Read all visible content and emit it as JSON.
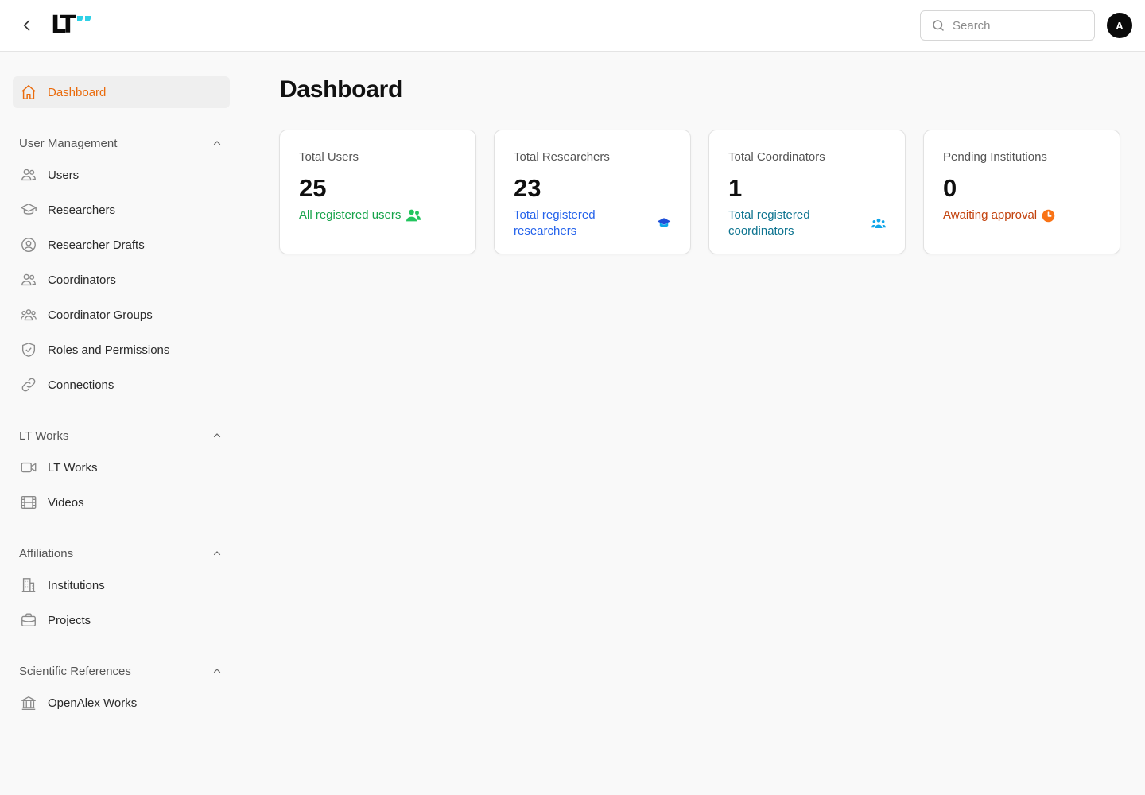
{
  "header": {
    "logo_text": "LT",
    "search_placeholder": "Search",
    "avatar_initial": "A"
  },
  "sidebar": {
    "dashboard": {
      "label": "Dashboard",
      "icon": "home-icon"
    },
    "sections": [
      {
        "title": "User Management",
        "items": [
          {
            "label": "Users",
            "icon": "users-icon"
          },
          {
            "label": "Researchers",
            "icon": "graduation-cap-icon"
          },
          {
            "label": "Researcher Drafts",
            "icon": "user-circle-icon"
          },
          {
            "label": "Coordinators",
            "icon": "users-icon"
          },
          {
            "label": "Coordinator Groups",
            "icon": "user-group-icon"
          },
          {
            "label": "Roles and Permissions",
            "icon": "shield-check-icon"
          },
          {
            "label": "Connections",
            "icon": "link-icon"
          }
        ]
      },
      {
        "title": "LT Works",
        "items": [
          {
            "label": "LT Works",
            "icon": "video-camera-icon"
          },
          {
            "label": "Videos",
            "icon": "film-icon"
          }
        ]
      },
      {
        "title": "Affiliations",
        "items": [
          {
            "label": "Institutions",
            "icon": "building-icon"
          },
          {
            "label": "Projects",
            "icon": "briefcase-icon"
          }
        ]
      },
      {
        "title": "Scientific References",
        "items": [
          {
            "label": "OpenAlex Works",
            "icon": "library-icon"
          }
        ]
      }
    ]
  },
  "main": {
    "title": "Dashboard",
    "cards": [
      {
        "title": "Total Users",
        "value": "25",
        "desc": "All registered users",
        "color": "#16a34a",
        "icon": "users-solid-icon"
      },
      {
        "title": "Total Researchers",
        "value": "23",
        "desc": "Total registered researchers",
        "color": "#2563eb",
        "icon": "graduation-cap-solid-icon"
      },
      {
        "title": "Total Coordinators",
        "value": "1",
        "desc": "Total registered coordinators",
        "color": "#0e7490",
        "icon": "user-group-solid-icon"
      },
      {
        "title": "Pending Institutions",
        "value": "0",
        "desc": "Awaiting approval",
        "color": "#c2410c",
        "icon": "clock-solid-icon"
      }
    ]
  },
  "colors": {
    "accent": "#ea6b0c",
    "logo_accent": "#2fd0e6"
  }
}
